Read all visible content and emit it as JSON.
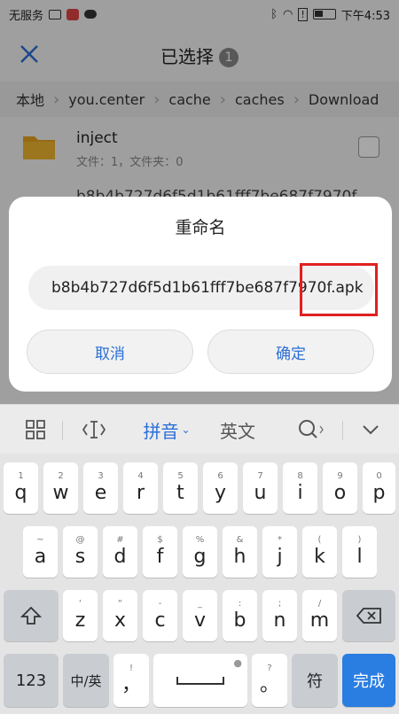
{
  "statusbar": {
    "carrier": "无服务",
    "time": "下午4:53"
  },
  "header": {
    "title": "已选择",
    "selected_count": "1"
  },
  "breadcrumbs": [
    "本地",
    "you.center",
    "cache",
    "caches",
    "Download"
  ],
  "files": [
    {
      "name": "inject",
      "meta": "文件：1，文件夹：0"
    },
    {
      "name": "b8b4b727d6f5d1b61fff7be687f7970f"
    }
  ],
  "dialog": {
    "title": "重命名",
    "input_value": "b8b4b727d6f5d1b61fff7be687f7970f.apk",
    "cancel_label": "取消",
    "ok_label": "确定"
  },
  "ime_toolbar": {
    "pinyin_label": "拼音",
    "english_label": "英文"
  },
  "keyboard": {
    "row1": [
      {
        "hint": "1",
        "key": "q"
      },
      {
        "hint": "2",
        "key": "w"
      },
      {
        "hint": "3",
        "key": "e"
      },
      {
        "hint": "4",
        "key": "r"
      },
      {
        "hint": "5",
        "key": "t"
      },
      {
        "hint": "6",
        "key": "y"
      },
      {
        "hint": "7",
        "key": "u"
      },
      {
        "hint": "8",
        "key": "i"
      },
      {
        "hint": "9",
        "key": "o"
      },
      {
        "hint": "0",
        "key": "p"
      }
    ],
    "row2": [
      {
        "hint": "~",
        "key": "a"
      },
      {
        "hint": "@",
        "key": "s"
      },
      {
        "hint": "#",
        "key": "d"
      },
      {
        "hint": "$",
        "key": "f"
      },
      {
        "hint": "%",
        "key": "g"
      },
      {
        "hint": "&",
        "key": "h"
      },
      {
        "hint": "*",
        "key": "j"
      },
      {
        "hint": "(",
        "key": "k"
      },
      {
        "hint": ")",
        "key": "l"
      }
    ],
    "row3": [
      {
        "hint": "‘",
        "key": "z"
      },
      {
        "hint": "“",
        "key": "x"
      },
      {
        "hint": "-",
        "key": "c"
      },
      {
        "hint": "_",
        "key": "v"
      },
      {
        "hint": ":",
        "key": "b"
      },
      {
        "hint": ";",
        "key": "n"
      },
      {
        "hint": "/",
        "key": "m"
      }
    ],
    "num_label": "123",
    "lang_label": "中/英",
    "comma": "，",
    "comma_hint": "!",
    "period": "。",
    "period_hint": "?",
    "symbol_label": "符",
    "done_label": "完成"
  },
  "colors": {
    "accent": "#2a7de1",
    "highlight": "#e02020",
    "folder": "#e6a31e"
  }
}
